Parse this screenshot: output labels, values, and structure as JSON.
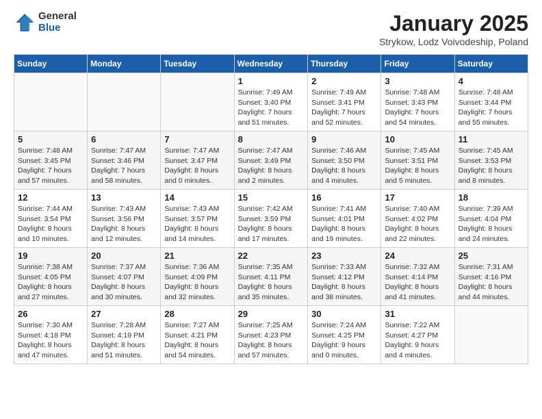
{
  "logo": {
    "general": "General",
    "blue": "Blue"
  },
  "title": "January 2025",
  "subtitle": "Strykow, Lodz Voivodeship, Poland",
  "days_of_week": [
    "Sunday",
    "Monday",
    "Tuesday",
    "Wednesday",
    "Thursday",
    "Friday",
    "Saturday"
  ],
  "weeks": [
    [
      {
        "day": "",
        "info": ""
      },
      {
        "day": "",
        "info": ""
      },
      {
        "day": "",
        "info": ""
      },
      {
        "day": "1",
        "info": "Sunrise: 7:49 AM\nSunset: 3:40 PM\nDaylight: 7 hours and 51 minutes."
      },
      {
        "day": "2",
        "info": "Sunrise: 7:49 AM\nSunset: 3:41 PM\nDaylight: 7 hours and 52 minutes."
      },
      {
        "day": "3",
        "info": "Sunrise: 7:48 AM\nSunset: 3:43 PM\nDaylight: 7 hours and 54 minutes."
      },
      {
        "day": "4",
        "info": "Sunrise: 7:48 AM\nSunset: 3:44 PM\nDaylight: 7 hours and 55 minutes."
      }
    ],
    [
      {
        "day": "5",
        "info": "Sunrise: 7:48 AM\nSunset: 3:45 PM\nDaylight: 7 hours and 57 minutes."
      },
      {
        "day": "6",
        "info": "Sunrise: 7:47 AM\nSunset: 3:46 PM\nDaylight: 7 hours and 58 minutes."
      },
      {
        "day": "7",
        "info": "Sunrise: 7:47 AM\nSunset: 3:47 PM\nDaylight: 8 hours and 0 minutes."
      },
      {
        "day": "8",
        "info": "Sunrise: 7:47 AM\nSunset: 3:49 PM\nDaylight: 8 hours and 2 minutes."
      },
      {
        "day": "9",
        "info": "Sunrise: 7:46 AM\nSunset: 3:50 PM\nDaylight: 8 hours and 4 minutes."
      },
      {
        "day": "10",
        "info": "Sunrise: 7:45 AM\nSunset: 3:51 PM\nDaylight: 8 hours and 5 minutes."
      },
      {
        "day": "11",
        "info": "Sunrise: 7:45 AM\nSunset: 3:53 PM\nDaylight: 8 hours and 8 minutes."
      }
    ],
    [
      {
        "day": "12",
        "info": "Sunrise: 7:44 AM\nSunset: 3:54 PM\nDaylight: 8 hours and 10 minutes."
      },
      {
        "day": "13",
        "info": "Sunrise: 7:43 AM\nSunset: 3:56 PM\nDaylight: 8 hours and 12 minutes."
      },
      {
        "day": "14",
        "info": "Sunrise: 7:43 AM\nSunset: 3:57 PM\nDaylight: 8 hours and 14 minutes."
      },
      {
        "day": "15",
        "info": "Sunrise: 7:42 AM\nSunset: 3:59 PM\nDaylight: 8 hours and 17 minutes."
      },
      {
        "day": "16",
        "info": "Sunrise: 7:41 AM\nSunset: 4:01 PM\nDaylight: 8 hours and 19 minutes."
      },
      {
        "day": "17",
        "info": "Sunrise: 7:40 AM\nSunset: 4:02 PM\nDaylight: 8 hours and 22 minutes."
      },
      {
        "day": "18",
        "info": "Sunrise: 7:39 AM\nSunset: 4:04 PM\nDaylight: 8 hours and 24 minutes."
      }
    ],
    [
      {
        "day": "19",
        "info": "Sunrise: 7:38 AM\nSunset: 4:05 PM\nDaylight: 8 hours and 27 minutes."
      },
      {
        "day": "20",
        "info": "Sunrise: 7:37 AM\nSunset: 4:07 PM\nDaylight: 8 hours and 30 minutes."
      },
      {
        "day": "21",
        "info": "Sunrise: 7:36 AM\nSunset: 4:09 PM\nDaylight: 8 hours and 32 minutes."
      },
      {
        "day": "22",
        "info": "Sunrise: 7:35 AM\nSunset: 4:11 PM\nDaylight: 8 hours and 35 minutes."
      },
      {
        "day": "23",
        "info": "Sunrise: 7:33 AM\nSunset: 4:12 PM\nDaylight: 8 hours and 38 minutes."
      },
      {
        "day": "24",
        "info": "Sunrise: 7:32 AM\nSunset: 4:14 PM\nDaylight: 8 hours and 41 minutes."
      },
      {
        "day": "25",
        "info": "Sunrise: 7:31 AM\nSunset: 4:16 PM\nDaylight: 8 hours and 44 minutes."
      }
    ],
    [
      {
        "day": "26",
        "info": "Sunrise: 7:30 AM\nSunset: 4:18 PM\nDaylight: 8 hours and 47 minutes."
      },
      {
        "day": "27",
        "info": "Sunrise: 7:28 AM\nSunset: 4:19 PM\nDaylight: 8 hours and 51 minutes."
      },
      {
        "day": "28",
        "info": "Sunrise: 7:27 AM\nSunset: 4:21 PM\nDaylight: 8 hours and 54 minutes."
      },
      {
        "day": "29",
        "info": "Sunrise: 7:25 AM\nSunset: 4:23 PM\nDaylight: 8 hours and 57 minutes."
      },
      {
        "day": "30",
        "info": "Sunrise: 7:24 AM\nSunset: 4:25 PM\nDaylight: 9 hours and 0 minutes."
      },
      {
        "day": "31",
        "info": "Sunrise: 7:22 AM\nSunset: 4:27 PM\nDaylight: 9 hours and 4 minutes."
      },
      {
        "day": "",
        "info": ""
      }
    ]
  ]
}
